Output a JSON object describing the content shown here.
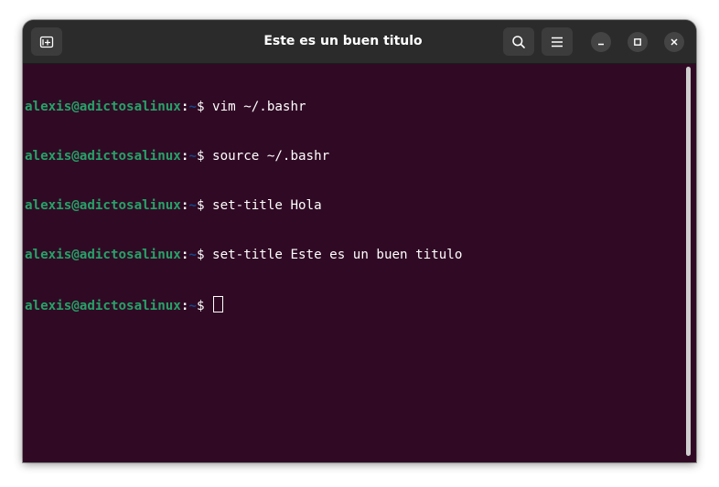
{
  "window": {
    "title": "Este es un buen titulo"
  },
  "headerbar": {
    "buttons": [
      {
        "name": "new-tab",
        "icon": "new-tab-icon"
      },
      {
        "name": "search",
        "icon": "search-icon"
      },
      {
        "name": "menu",
        "icon": "hamburger-menu-icon"
      }
    ],
    "window_controls": [
      "minimize-icon",
      "maximize-icon",
      "close-icon"
    ]
  },
  "terminal": {
    "prompt": {
      "user_host": "alexis@adictosalinux",
      "separator": ":",
      "path": "~",
      "symbol": "$"
    },
    "lines": [
      {
        "command": " vim ~/.bashr"
      },
      {
        "command": " source ~/.bashr"
      },
      {
        "command": " set-title Hola"
      },
      {
        "command": " set-title Este es un buen titulo"
      },
      {
        "command": " "
      }
    ]
  },
  "colors": {
    "background": "#300a24",
    "headerbar": "#2b2b2b",
    "prompt_user": "#26a269",
    "prompt_path": "#12488b",
    "text": "#ffffff"
  }
}
